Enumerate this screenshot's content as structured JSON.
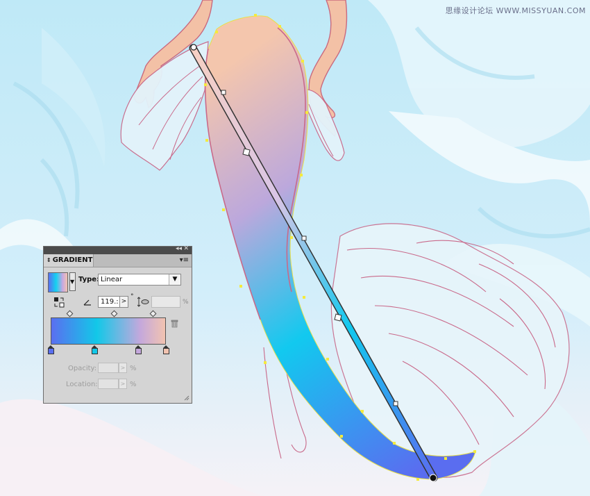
{
  "watermark": "思缘设计论坛 WWW.MISSYUAN.COM",
  "gradient_panel": {
    "title": "GRADIENT",
    "collapse_icon": "double-chevron-left-icon",
    "menu_icon": "panel-menu-icon",
    "type_label": "Type:",
    "type_value": "Linear",
    "angle_value": "119.:",
    "degree_symbol": "°",
    "aspect_unit": "%",
    "opacity_label": "Opacity:",
    "opacity_unit": "%",
    "location_label": "Location:",
    "location_unit": "%",
    "stops": [
      "#5a6ff0",
      "#12c8e8",
      "#c4a8dc",
      "#f2c3b0"
    ],
    "colors": {
      "panel_bg": "#d4d4d4",
      "title_bar": "#4b4b4b"
    }
  }
}
